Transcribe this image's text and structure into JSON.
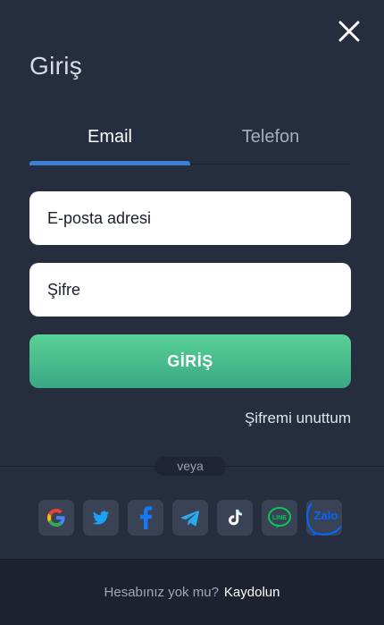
{
  "title": "Giriş",
  "tabs": [
    {
      "label": "Email",
      "active": true
    },
    {
      "label": "Telefon",
      "active": false
    }
  ],
  "form": {
    "email_placeholder": "E-posta adresi",
    "password_placeholder": "Şifre",
    "submit_label": "GİRİŞ",
    "forgot_label": "Şifremi unuttum"
  },
  "divider_text": "veya",
  "socials": [
    {
      "name": "google",
      "icon": "google-icon"
    },
    {
      "name": "twitter",
      "icon": "twitter-icon"
    },
    {
      "name": "facebook",
      "icon": "facebook-icon"
    },
    {
      "name": "telegram",
      "icon": "telegram-icon"
    },
    {
      "name": "tiktok",
      "icon": "tiktok-icon"
    },
    {
      "name": "line",
      "icon": "line-icon",
      "text": "LINE"
    },
    {
      "name": "zalo",
      "icon": "zalo-icon",
      "text": "Zalo"
    }
  ],
  "footer": {
    "question": "Hesabınız yok mu?",
    "signup_label": "Kaydolun"
  },
  "colors": {
    "background": "#262d3f",
    "accent_tab": "#3b7fd1",
    "button_gradient_top": "#58d296",
    "button_gradient_bottom": "#3aa784",
    "social_tile": "#3a4255",
    "footer_bg": "#1d2230"
  }
}
